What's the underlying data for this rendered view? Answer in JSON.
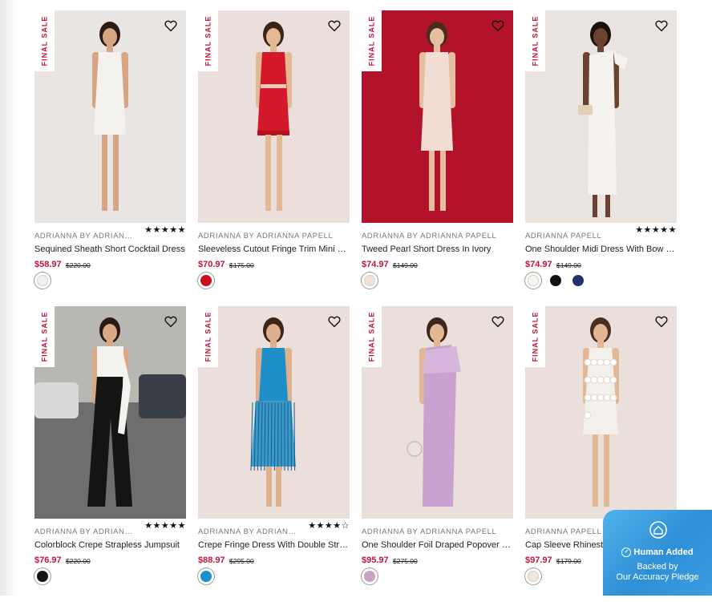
{
  "tag_label": "FINAL SALE",
  "colors": {
    "sale_price": "#c2163b",
    "badge": "#3a9be0"
  },
  "products": [
    {
      "brand": "ADRIANNA BY ADRIANNA PAPELL",
      "title": "Sequined Sheath Short Cocktail Dress",
      "price": "$58.97",
      "was": "$220.00",
      "rating": 5,
      "stars": "★★★★★",
      "swatches": [
        "#f3f1ee"
      ],
      "photo": {
        "bg": "#e8e5e3",
        "dress": "#f4f2ef",
        "skin": "#d6a583",
        "hair": "#2a1c14"
      }
    },
    {
      "brand": "ADRIANNA BY ADRIANNA PAPELL",
      "title": "Sleeveless Cutout Fringe Trim Mini Dress",
      "price": "$70.97",
      "was": "$175.00",
      "rating": 0,
      "stars": "",
      "swatches": [
        "#c8101f"
      ],
      "photo": {
        "bg": "#eadfdb",
        "dress": "#d3182a",
        "skin": "#e3b895",
        "hair": "#3a2418"
      }
    },
    {
      "brand": "ADRIANNA BY ADRIANNA PAPELL",
      "title": "Tweed Pearl Short Dress In Ivory",
      "price": "$74.97",
      "was": "$149.00",
      "rating": 0,
      "stars": "",
      "swatches": [
        "#f0e2d8"
      ],
      "photo": {
        "bg": "#b3132a",
        "dress": "#f1ddd4",
        "skin": "#e6bfa0",
        "hair": "#4a2c1c"
      }
    },
    {
      "brand": "ADRIANNA PAPELL",
      "title": "One Shoulder Midi Dress With Bow Detail",
      "price": "$74.97",
      "was": "$149.00",
      "rating": 5,
      "stars": "★★★★★",
      "swatches": [
        "#f7f5f2",
        "#111111",
        "#27306e"
      ],
      "photo": {
        "bg": "#eae4e1",
        "dress": "#f6f3ee",
        "skin": "#6b4230",
        "hair": "#1a110c"
      }
    },
    {
      "brand": "ADRIANNA BY ADRIANNA PAPELL",
      "title": "Colorblock Crepe Strapless Jumpsuit",
      "price": "$76.97",
      "was": "$220.00",
      "rating": 5,
      "stars": "★★★★★",
      "swatches": [
        "#141414"
      ],
      "photo": {
        "bg": "#8a8a8a",
        "dress": "#141414",
        "skin": "#d9a986",
        "hair": "#2a1a12"
      }
    },
    {
      "brand": "ADRIANNA BY ADRIANNA PAPELL",
      "title": "Crepe Fringe Dress With Double Straps",
      "price": "$88.97",
      "was": "$295.00",
      "rating": 4.5,
      "stars": "★★★★☆",
      "swatches": [
        "#1a8fca"
      ],
      "photo": {
        "bg": "#eadfdb",
        "dress": "#1e8fc9",
        "skin": "#deb08e",
        "hair": "#3b2418"
      }
    },
    {
      "brand": "ADRIANNA BY ADRIANNA PAPELL",
      "title": "One Shoulder Foil Draped Popover Gown",
      "price": "$95.97",
      "was": "$275.00",
      "rating": 0,
      "stars": "",
      "swatches": [
        "#c9a2bf"
      ],
      "photo": {
        "bg": "#eadfdb",
        "dress": "#c9a3cf",
        "skin": "#e2b796",
        "hair": "#3c2519"
      }
    },
    {
      "brand": "ADRIANNA PAPELL",
      "title": "Cap Sleeve Rhinestone Button Lace Dress",
      "price": "$97.97",
      "was": "$179.00",
      "rating": 0,
      "stars": "",
      "swatches": [
        "#efe8e0"
      ],
      "photo": {
        "bg": "#eadfdb",
        "dress": "#f3efea",
        "skin": "#e2b796",
        "hair": "#4a2e1f"
      }
    }
  ],
  "badge": {
    "title": "Human Added",
    "line1": "Backed by",
    "line2": "Our Accuracy Pledge"
  }
}
